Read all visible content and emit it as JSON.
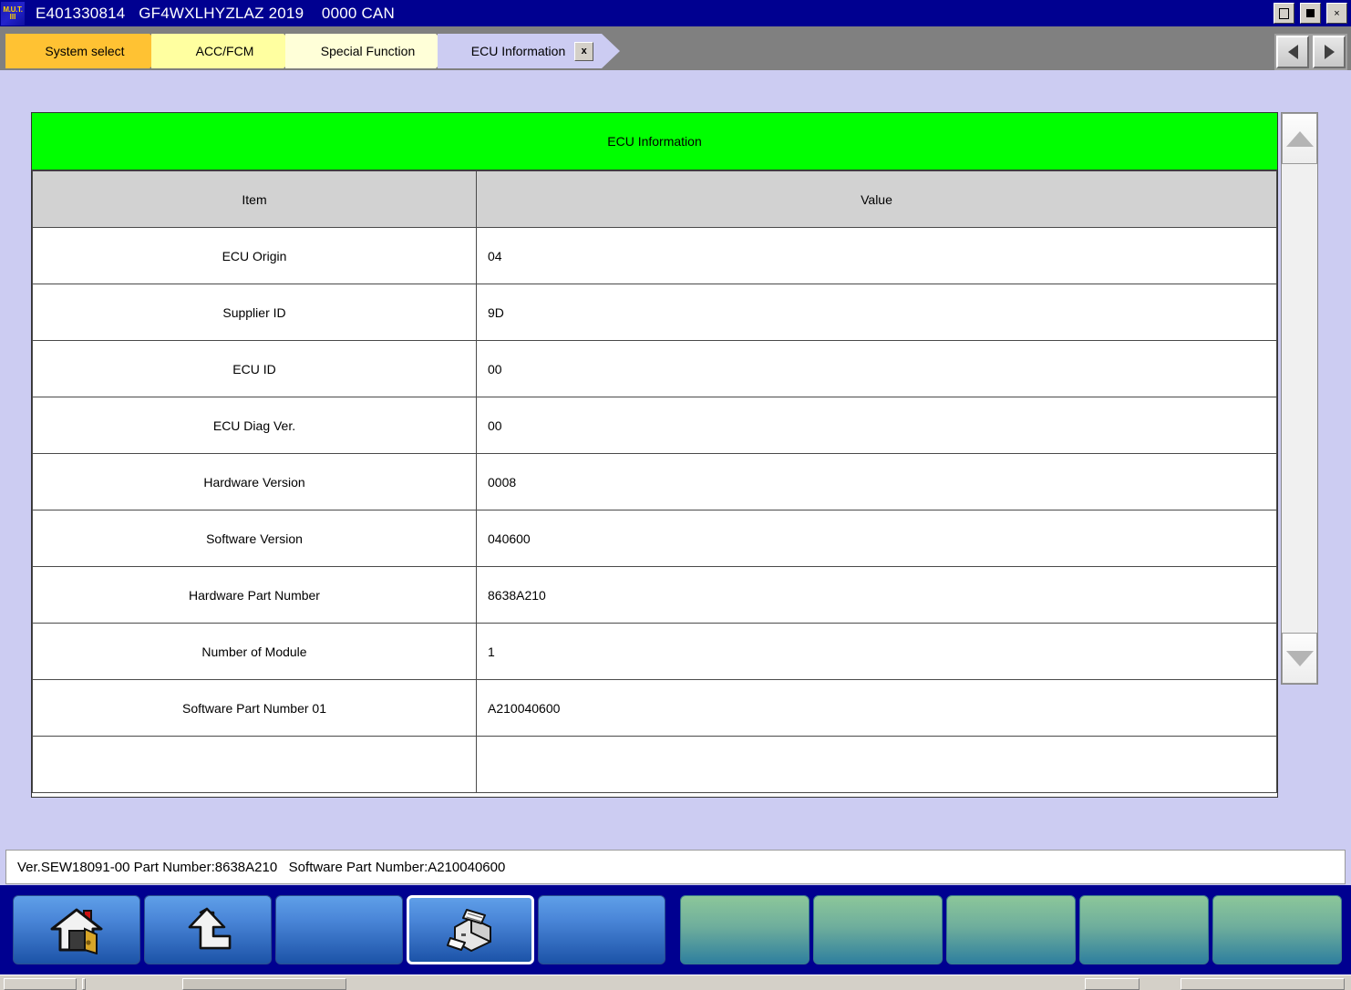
{
  "window": {
    "app_icon_line1": "M.U.T.",
    "app_icon_line2": "III",
    "title": "E401330814   GF4WXLHYZLAZ 2019    0000 CAN",
    "controls": {
      "minimize": "minimize-icon",
      "maximize": "maximize-icon",
      "close": "×"
    }
  },
  "breadcrumbs": [
    {
      "label": "System select",
      "color": "#ffc233",
      "active": false
    },
    {
      "label": "ACC/FCM",
      "color": "#ffffa0",
      "active": false
    },
    {
      "label": "Special Function",
      "color": "#ffffd8",
      "active": false
    },
    {
      "label": "ECU Information",
      "color": "#ccccf2",
      "active": true,
      "close_label": "x"
    }
  ],
  "nav": {
    "prev_icon": "triangle-left-icon",
    "next_icon": "triangle-right-icon"
  },
  "panel": {
    "title": "ECU Information",
    "title_bg": "#00ff00",
    "columns": [
      "Item",
      "Value"
    ],
    "rows": [
      {
        "item": "ECU Origin",
        "value": "04"
      },
      {
        "item": "Supplier ID",
        "value": "9D"
      },
      {
        "item": "ECU ID",
        "value": "00"
      },
      {
        "item": "ECU Diag Ver.",
        "value": "00"
      },
      {
        "item": "Hardware Version",
        "value": "0008"
      },
      {
        "item": "Software Version",
        "value": "040600"
      },
      {
        "item": "Hardware Part Number",
        "value": "8638A210"
      },
      {
        "item": "Number of Module",
        "value": "1"
      },
      {
        "item": "Software Part Number 01",
        "value": "A210040600"
      },
      {
        "item": "",
        "value": ""
      }
    ]
  },
  "scrollbar": {
    "up_icon": "scroll-up-arrow-icon",
    "down_icon": "scroll-down-arrow-icon"
  },
  "statusbar": {
    "text": "Ver.SEW18091-00 Part Number:8638A210   Software Part Number:A210040600"
  },
  "toolbar": {
    "left_buttons": [
      {
        "icon": "home-icon",
        "label": ""
      },
      {
        "icon": "up-arrow-icon",
        "label": ""
      },
      {
        "icon": "",
        "label": ""
      },
      {
        "icon": "printer-icon",
        "label": "",
        "focused": true
      },
      {
        "icon": "",
        "label": ""
      }
    ],
    "right_buttons": [
      {
        "label": ""
      },
      {
        "label": ""
      },
      {
        "label": ""
      },
      {
        "label": ""
      },
      {
        "label": ""
      }
    ]
  },
  "colors": {
    "title_bar": "#000090",
    "workspace": "#ccccf2",
    "tabstrip": "#808080",
    "header_green": "#00ff00",
    "column_header_gray": "#d2d2d2"
  }
}
